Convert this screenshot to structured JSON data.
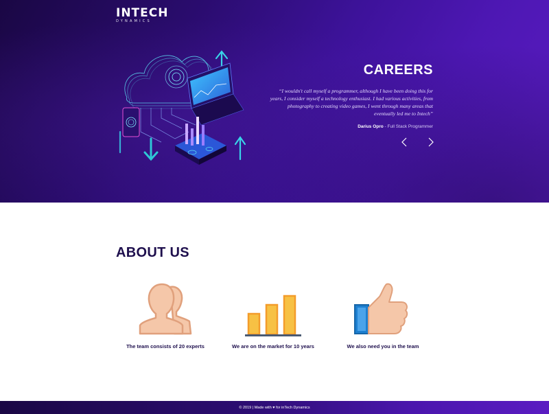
{
  "brand": {
    "name": "INTECH",
    "tagline": "DYNAMICS"
  },
  "hero": {
    "title": "CAREERS",
    "quote": "“I wouldn't call myself a programmer, although I have been doing this for years, I consider myself a technology enthusiast. I had various activities, from photography to creating video games, I went through many areas that eventually led me to Intech”",
    "author_name": "Darius Opro",
    "author_sep": " - ",
    "author_role": "Full Stack Programmer",
    "prev_icon": "chevron-left-icon",
    "next_icon": "chevron-right-icon",
    "illustration": "cloud-computing-illustration"
  },
  "about": {
    "title": "ABOUT US",
    "features": [
      {
        "icon": "team-icon",
        "label": "The team consists of 20 experts"
      },
      {
        "icon": "bar-chart-icon",
        "label": "We are on the market for 10 years"
      },
      {
        "icon": "thumbs-up-icon",
        "label": "We also need you in the team"
      }
    ]
  },
  "footer": {
    "prefix": "© 2019 | Made with ",
    "heart": "♥",
    "suffix": " for inTech Dynamics"
  },
  "colors": {
    "hero_dark": "#1a0744",
    "hero_light": "#5a1cc2",
    "heading": "#1e0f4d",
    "accent_cyan": "#2fd4ea",
    "bar_orange": "#f39c2b",
    "bar_yellow": "#f7c144",
    "thumb_blue": "#1d7fd0",
    "skin": "#f5c7a9"
  }
}
